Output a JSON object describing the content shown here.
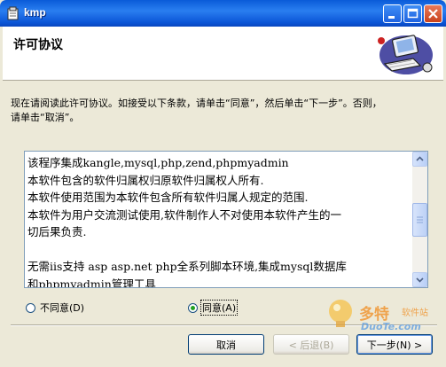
{
  "window": {
    "title": "kmp"
  },
  "header": {
    "title": "许可协议"
  },
  "instructions": {
    "line1": "现在请阅读此许可协议。如接受以下条款，请单击“同意”，然后单击“下一步”。否则，",
    "line2": "请单击“取消”。"
  },
  "license": {
    "lines": [
      "该程序集成kangle,mysql,php,zend,phpmyadmin",
      "本软件包含的软件归属权归原软件归属权人所有.",
      "本软件使用范围为本软件包含所有软件归属人规定的范围.",
      "本软件为用户交流测试使用,软件制作人不对使用本软件产生的一",
      "切后果负责.",
      "",
      "无需iis支持 asp asp.net php全系列脚本环境,集成mysql数据库",
      "和phpmyadmin管理工具"
    ]
  },
  "options": {
    "disagree": {
      "label": "不同意(D)",
      "selected": false
    },
    "agree": {
      "label": "同意(A)",
      "selected": true
    }
  },
  "buttons": {
    "cancel": "取消",
    "back": "< 后退(B)",
    "next": "下一步(N) >"
  },
  "watermark": {
    "brand": "多特",
    "sub": "软件站",
    "url": "DuoTe.com"
  },
  "colors": {
    "titlebar": "#0a5bd8",
    "face": "#ece9d8",
    "radio_on": "#21a121"
  }
}
